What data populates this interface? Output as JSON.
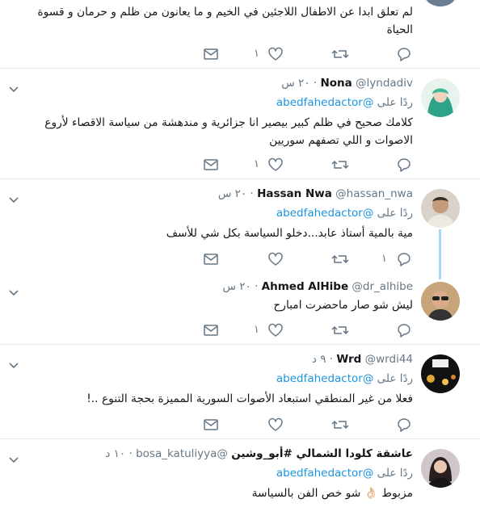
{
  "tweets": [
    {
      "text": "لم تعلق ابدا عن الاطفال اللاجئين في الخيم و ما يعانون من ظلم و حرمان و قسوة الحياة",
      "actions": {
        "reply_count": "",
        "retweet_count": "",
        "like_count": "١"
      }
    },
    {
      "name": "Nona",
      "handle": "@lyndadiv",
      "time": "٢٠ س",
      "replying_prefix": "ردًا على",
      "mention": "@abedfahedactor",
      "text": "كلامك صحيح في ظلم كبير بيصير انا جزائرية و مندهشة من سياسة الاقصاء لأروع الاصوات و اللي تصفهم سوريين",
      "actions": {
        "reply_count": "",
        "retweet_count": "",
        "like_count": "١"
      }
    },
    {
      "name": "Hassan Nwa",
      "handle": "@hassan_nwa",
      "time": "٢٠ س",
      "replying_prefix": "ردًا على",
      "mention": "@abedfahedactor",
      "text": "مية بالمية أستاذ عابد...دخلو السياسة بكل شي للأسف",
      "actions": {
        "reply_count": "١",
        "retweet_count": "",
        "like_count": ""
      }
    },
    {
      "name": "Ahmed AlHibe",
      "handle": "@dr_alhibe",
      "time": "٢٠ س",
      "text": "ليش شو صار ماحضرت امبارح",
      "actions": {
        "reply_count": "",
        "retweet_count": "",
        "like_count": "١"
      }
    },
    {
      "name": "Wrd",
      "handle": "@wrdi44",
      "time": "٩ د",
      "replying_prefix": "ردًا على",
      "mention": "@abedfahedactor",
      "text": "فعلا من غير المنطقي استبعاد الأصوات السورية المميزة بحجة التنوع ..!",
      "actions": {
        "reply_count": "",
        "retweet_count": "",
        "like_count": ""
      }
    },
    {
      "name": "عاشقة كلودا الشمالي #أبو_وشين",
      "handle": "@bosa_katuliyya",
      "time": "١٠ د",
      "replying_prefix": "ردًا على",
      "mention": "@abedfahedactor",
      "text": "مزبوط 👌🏻 شو خص الفن بالسياسة"
    }
  ],
  "colors": {
    "accent": "#1b95e0",
    "muted": "#657786",
    "divider": "#e6ecf0",
    "thread": "#a9d8f5"
  }
}
